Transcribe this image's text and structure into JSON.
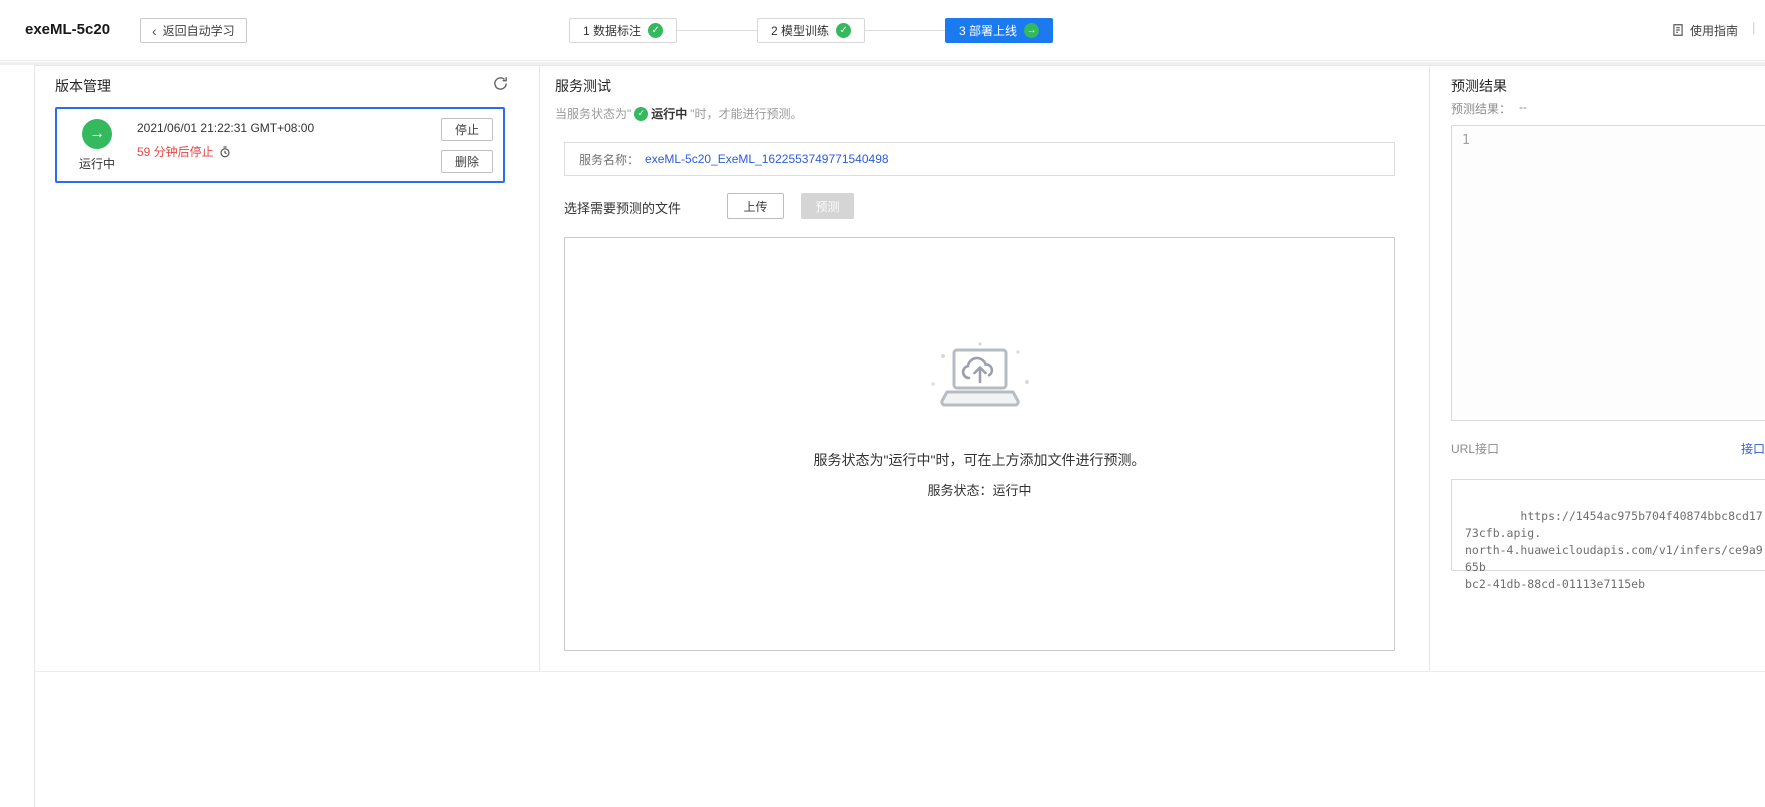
{
  "header": {
    "title": "exeML-5c20",
    "back_button": "返回自动学习",
    "steps": [
      {
        "label": "1 数据标注",
        "status": "done"
      },
      {
        "label": "2 模型训练",
        "status": "done"
      },
      {
        "label": "3 部署上线",
        "status": "active"
      }
    ],
    "guide_link": "使用指南",
    "separator": "|"
  },
  "version_panel": {
    "title": "版本管理",
    "version": {
      "status": "运行中",
      "timestamp": "2021/06/01 21:22:31 GMT+08:00",
      "auto_stop": "59 分钟后停止",
      "stop_button": "停止",
      "delete_button": "删除"
    }
  },
  "service_panel": {
    "title": "服务测试",
    "hint_prefix": "当服务状态为\"",
    "hint_status": "运行中",
    "hint_suffix": "\"时，才能进行预测。",
    "service_name_label": "服务名称：",
    "service_name": "exeML-5c20_ExeML_1622553749771540498",
    "file_label": "选择需要预测的文件",
    "upload_button": "上传",
    "predict_button": "预测",
    "empty_hint_line1": "服务状态为\"运行中\"时，可在上方添加文件进行预测。",
    "empty_hint_line2": "服务状态：运行中"
  },
  "result_panel": {
    "title": "预测结果",
    "result_label": "预测结果：",
    "result_value": "--",
    "editor_line_number": "1",
    "url_label": "URL接口",
    "url_link": "接口调用",
    "url_value": "https://1454ac975b704f40874bbc8cd1773cfb.apig.\nnorth-4.huaweicloudapis.com/v1/infers/ce9a965b\nbc2-41db-88cd-01113e7115eb"
  },
  "colors": {
    "accent_blue": "#1b7af0",
    "link_blue": "#2b5ce0",
    "selected_border_blue": "#2b6bf0",
    "success_green": "#34b95e",
    "danger_red": "#e64545"
  }
}
